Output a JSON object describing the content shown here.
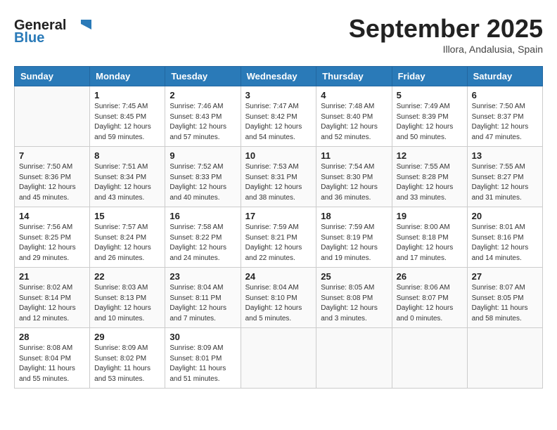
{
  "header": {
    "logo_general": "General",
    "logo_blue": "Blue",
    "month": "September 2025",
    "location": "Illora, Andalusia, Spain"
  },
  "weekdays": [
    "Sunday",
    "Monday",
    "Tuesday",
    "Wednesday",
    "Thursday",
    "Friday",
    "Saturday"
  ],
  "weeks": [
    [
      {
        "day": "",
        "sunrise": "",
        "sunset": "",
        "daylight": ""
      },
      {
        "day": "1",
        "sunrise": "Sunrise: 7:45 AM",
        "sunset": "Sunset: 8:45 PM",
        "daylight": "Daylight: 12 hours and 59 minutes."
      },
      {
        "day": "2",
        "sunrise": "Sunrise: 7:46 AM",
        "sunset": "Sunset: 8:43 PM",
        "daylight": "Daylight: 12 hours and 57 minutes."
      },
      {
        "day": "3",
        "sunrise": "Sunrise: 7:47 AM",
        "sunset": "Sunset: 8:42 PM",
        "daylight": "Daylight: 12 hours and 54 minutes."
      },
      {
        "day": "4",
        "sunrise": "Sunrise: 7:48 AM",
        "sunset": "Sunset: 8:40 PM",
        "daylight": "Daylight: 12 hours and 52 minutes."
      },
      {
        "day": "5",
        "sunrise": "Sunrise: 7:49 AM",
        "sunset": "Sunset: 8:39 PM",
        "daylight": "Daylight: 12 hours and 50 minutes."
      },
      {
        "day": "6",
        "sunrise": "Sunrise: 7:50 AM",
        "sunset": "Sunset: 8:37 PM",
        "daylight": "Daylight: 12 hours and 47 minutes."
      }
    ],
    [
      {
        "day": "7",
        "sunrise": "Sunrise: 7:50 AM",
        "sunset": "Sunset: 8:36 PM",
        "daylight": "Daylight: 12 hours and 45 minutes."
      },
      {
        "day": "8",
        "sunrise": "Sunrise: 7:51 AM",
        "sunset": "Sunset: 8:34 PM",
        "daylight": "Daylight: 12 hours and 43 minutes."
      },
      {
        "day": "9",
        "sunrise": "Sunrise: 7:52 AM",
        "sunset": "Sunset: 8:33 PM",
        "daylight": "Daylight: 12 hours and 40 minutes."
      },
      {
        "day": "10",
        "sunrise": "Sunrise: 7:53 AM",
        "sunset": "Sunset: 8:31 PM",
        "daylight": "Daylight: 12 hours and 38 minutes."
      },
      {
        "day": "11",
        "sunrise": "Sunrise: 7:54 AM",
        "sunset": "Sunset: 8:30 PM",
        "daylight": "Daylight: 12 hours and 36 minutes."
      },
      {
        "day": "12",
        "sunrise": "Sunrise: 7:55 AM",
        "sunset": "Sunset: 8:28 PM",
        "daylight": "Daylight: 12 hours and 33 minutes."
      },
      {
        "day": "13",
        "sunrise": "Sunrise: 7:55 AM",
        "sunset": "Sunset: 8:27 PM",
        "daylight": "Daylight: 12 hours and 31 minutes."
      }
    ],
    [
      {
        "day": "14",
        "sunrise": "Sunrise: 7:56 AM",
        "sunset": "Sunset: 8:25 PM",
        "daylight": "Daylight: 12 hours and 29 minutes."
      },
      {
        "day": "15",
        "sunrise": "Sunrise: 7:57 AM",
        "sunset": "Sunset: 8:24 PM",
        "daylight": "Daylight: 12 hours and 26 minutes."
      },
      {
        "day": "16",
        "sunrise": "Sunrise: 7:58 AM",
        "sunset": "Sunset: 8:22 PM",
        "daylight": "Daylight: 12 hours and 24 minutes."
      },
      {
        "day": "17",
        "sunrise": "Sunrise: 7:59 AM",
        "sunset": "Sunset: 8:21 PM",
        "daylight": "Daylight: 12 hours and 22 minutes."
      },
      {
        "day": "18",
        "sunrise": "Sunrise: 7:59 AM",
        "sunset": "Sunset: 8:19 PM",
        "daylight": "Daylight: 12 hours and 19 minutes."
      },
      {
        "day": "19",
        "sunrise": "Sunrise: 8:00 AM",
        "sunset": "Sunset: 8:18 PM",
        "daylight": "Daylight: 12 hours and 17 minutes."
      },
      {
        "day": "20",
        "sunrise": "Sunrise: 8:01 AM",
        "sunset": "Sunset: 8:16 PM",
        "daylight": "Daylight: 12 hours and 14 minutes."
      }
    ],
    [
      {
        "day": "21",
        "sunrise": "Sunrise: 8:02 AM",
        "sunset": "Sunset: 8:14 PM",
        "daylight": "Daylight: 12 hours and 12 minutes."
      },
      {
        "day": "22",
        "sunrise": "Sunrise: 8:03 AM",
        "sunset": "Sunset: 8:13 PM",
        "daylight": "Daylight: 12 hours and 10 minutes."
      },
      {
        "day": "23",
        "sunrise": "Sunrise: 8:04 AM",
        "sunset": "Sunset: 8:11 PM",
        "daylight": "Daylight: 12 hours and 7 minutes."
      },
      {
        "day": "24",
        "sunrise": "Sunrise: 8:04 AM",
        "sunset": "Sunset: 8:10 PM",
        "daylight": "Daylight: 12 hours and 5 minutes."
      },
      {
        "day": "25",
        "sunrise": "Sunrise: 8:05 AM",
        "sunset": "Sunset: 8:08 PM",
        "daylight": "Daylight: 12 hours and 3 minutes."
      },
      {
        "day": "26",
        "sunrise": "Sunrise: 8:06 AM",
        "sunset": "Sunset: 8:07 PM",
        "daylight": "Daylight: 12 hours and 0 minutes."
      },
      {
        "day": "27",
        "sunrise": "Sunrise: 8:07 AM",
        "sunset": "Sunset: 8:05 PM",
        "daylight": "Daylight: 11 hours and 58 minutes."
      }
    ],
    [
      {
        "day": "28",
        "sunrise": "Sunrise: 8:08 AM",
        "sunset": "Sunset: 8:04 PM",
        "daylight": "Daylight: 11 hours and 55 minutes."
      },
      {
        "day": "29",
        "sunrise": "Sunrise: 8:09 AM",
        "sunset": "Sunset: 8:02 PM",
        "daylight": "Daylight: 11 hours and 53 minutes."
      },
      {
        "day": "30",
        "sunrise": "Sunrise: 8:09 AM",
        "sunset": "Sunset: 8:01 PM",
        "daylight": "Daylight: 11 hours and 51 minutes."
      },
      {
        "day": "",
        "sunrise": "",
        "sunset": "",
        "daylight": ""
      },
      {
        "day": "",
        "sunrise": "",
        "sunset": "",
        "daylight": ""
      },
      {
        "day": "",
        "sunrise": "",
        "sunset": "",
        "daylight": ""
      },
      {
        "day": "",
        "sunrise": "",
        "sunset": "",
        "daylight": ""
      }
    ]
  ]
}
